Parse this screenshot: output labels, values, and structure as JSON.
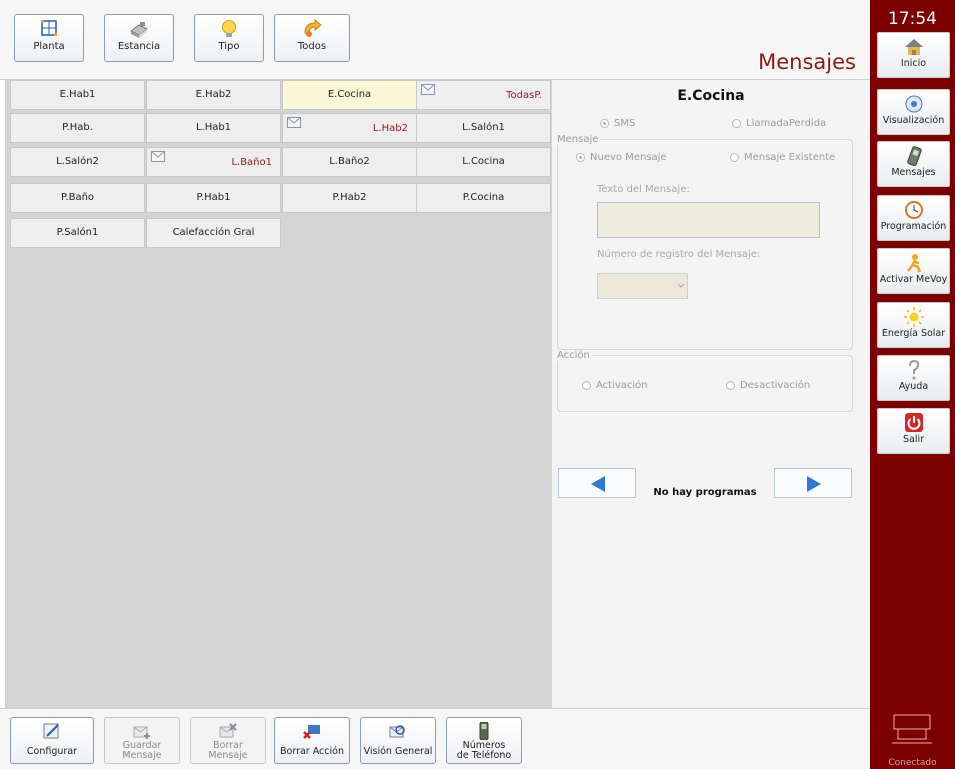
{
  "toolbar": {
    "buttons": [
      {
        "label": "Planta",
        "icon": "floorplan-icon"
      },
      {
        "label": "Estancia",
        "icon": "room-icon"
      },
      {
        "label": "Tipo",
        "icon": "lightbulb-icon"
      },
      {
        "label": "Todos",
        "icon": "all-devices-icon"
      }
    ],
    "title": "Mensajes"
  },
  "grid": {
    "cells": [
      {
        "label": "E.Hab1"
      },
      {
        "label": "E.Hab2"
      },
      {
        "label": "E.Cocina",
        "selected": true
      },
      {
        "label": "TodasP.",
        "has_message": true
      },
      {
        "label": "P.Hab."
      },
      {
        "label": "L.Hab1"
      },
      {
        "label": "L.Hab2",
        "has_message": true
      },
      {
        "label": "L.Salón1"
      },
      {
        "label": "L.Salón2"
      },
      {
        "label": "L.Baño1",
        "has_message": true
      },
      {
        "label": "L.Baño2"
      },
      {
        "label": "L.Cocina"
      },
      {
        "label": "P.Baño"
      },
      {
        "label": "P.Hab1"
      },
      {
        "label": "P.Hab2"
      },
      {
        "label": "P.Cocina"
      },
      {
        "label": "P.Salón1"
      },
      {
        "label": "Calefacción Gral"
      }
    ]
  },
  "panel": {
    "heading": "E.Cocina",
    "channel": {
      "sms_label": "SMS",
      "missed_call_label": "LlamadaPerdida",
      "selected": "SMS"
    },
    "message_group": {
      "legend": "Mensaje",
      "new_label": "Nuevo Mensaje",
      "existing_label": "Mensaje Existente",
      "selected": "Nuevo Mensaje",
      "text_label": "Texto del Mensaje:",
      "text_value": "",
      "register_label": "Número de registro del Mensaje:",
      "register_value": ""
    },
    "action_group": {
      "legend": "Acción",
      "activation_label": "Activación",
      "deactivation_label": "Desactivación"
    },
    "nav": {
      "status": "No hay programas"
    }
  },
  "sidebar": {
    "clock": "17:54",
    "items": [
      {
        "label": "Inicio",
        "icon": "home-icon"
      },
      {
        "label": "Visualización",
        "icon": "visualization-icon"
      },
      {
        "label": "Mensajes",
        "icon": "phone-icon"
      },
      {
        "label": "Programación",
        "icon": "clock-icon"
      },
      {
        "label": "Activar MeVoy",
        "icon": "leaving-icon"
      },
      {
        "label": "Energía Solar",
        "icon": "sun-icon"
      },
      {
        "label": "Ayuda",
        "icon": "help-icon"
      },
      {
        "label": "Salir",
        "icon": "power-icon"
      }
    ],
    "status": "Conectado"
  },
  "bottombar": {
    "buttons": [
      {
        "label": "Configurar",
        "enabled": true
      },
      {
        "label": "Guardar Mensaje",
        "enabled": false
      },
      {
        "label": "Borrar Mensaje",
        "enabled": false
      },
      {
        "label": "Borrar Acción",
        "enabled": true
      },
      {
        "label": "Visión General",
        "enabled": true
      },
      {
        "label": "Números de Teléfono",
        "enabled": true
      }
    ]
  },
  "colors": {
    "accent": "#7c0000",
    "title": "#8b1a1a",
    "selected_cell": "#fbf8d8",
    "arrow": "#2f7ad6"
  }
}
